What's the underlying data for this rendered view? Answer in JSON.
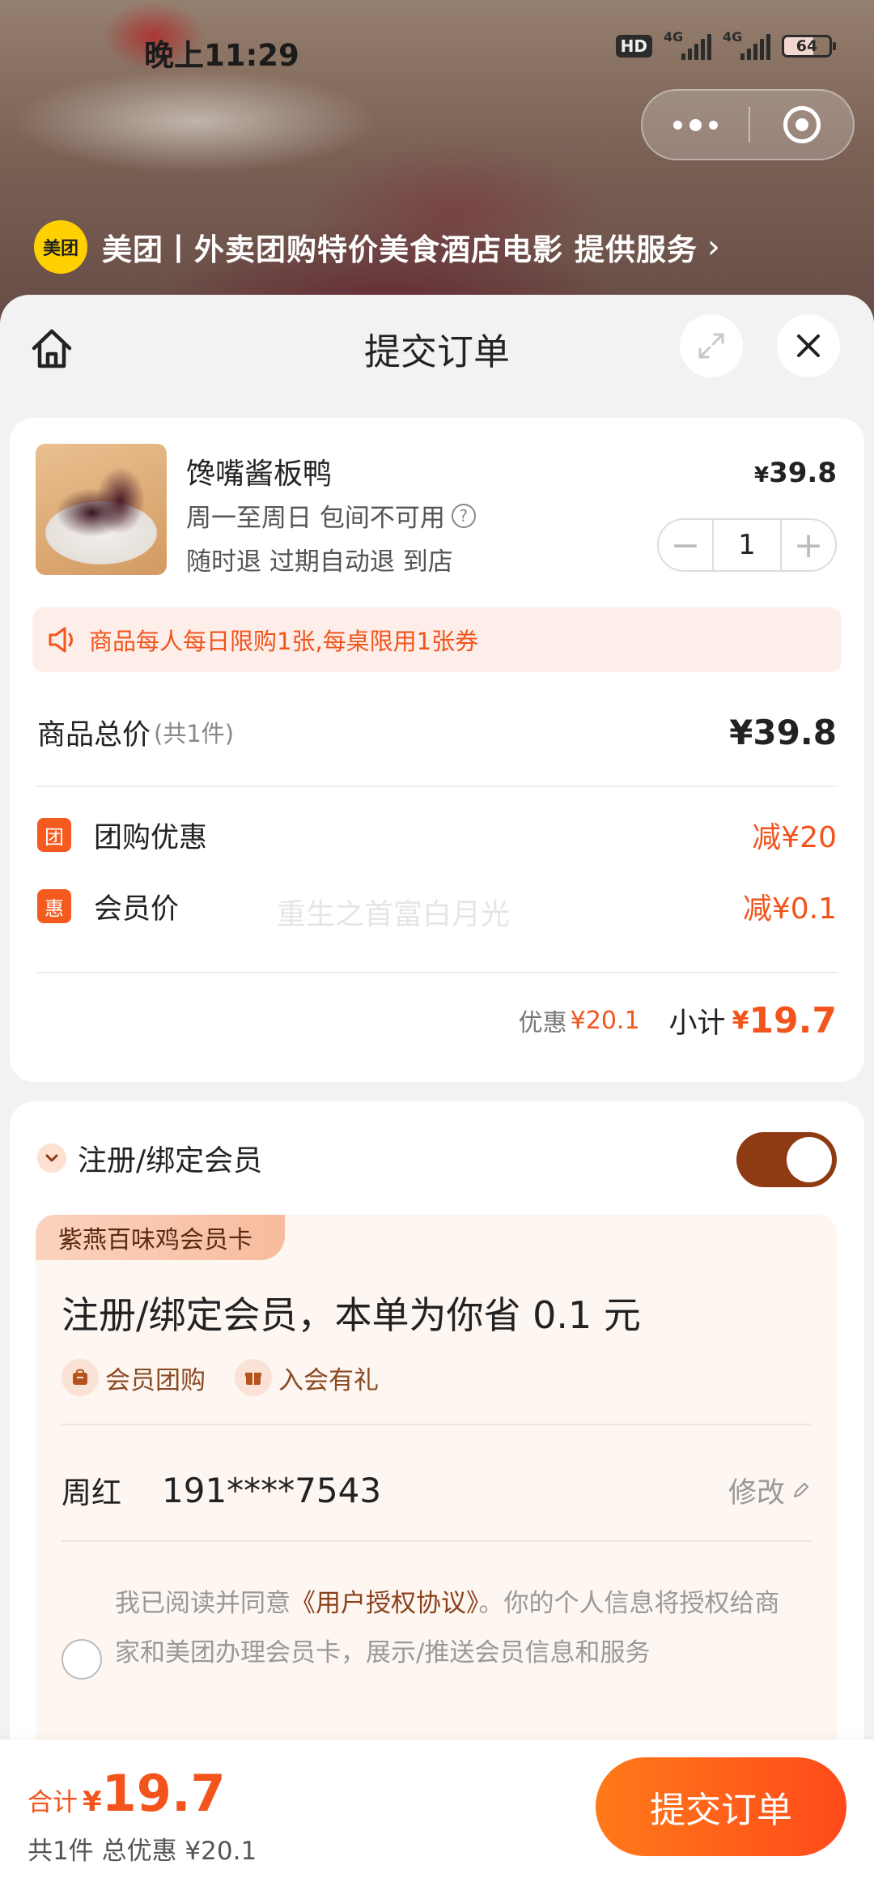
{
  "status_bar": {
    "time": "晚上11:29",
    "hd": "HD",
    "net1": "4G",
    "net2": "4G",
    "battery": "64"
  },
  "service": {
    "logo_text": "美团",
    "text": "美团丨外卖团购特价美食酒店电影 提供服务",
    "chevron": "›"
  },
  "header": {
    "title": "提交订单"
  },
  "product": {
    "name": "馋嘴酱板鸭",
    "sub1": "周一至周日 包间不可用",
    "help": "?",
    "sub2": "随时退 过期自动退 到店",
    "price_cur": "¥",
    "price": "39.8",
    "qty": "1",
    "minus": "−",
    "plus": "+"
  },
  "notice": {
    "text": "商品每人每日限购1张,每桌限用1张券"
  },
  "totals": {
    "label": "商品总价",
    "count": "(共1件)",
    "value": "¥39.8"
  },
  "discounts": [
    {
      "badge": "团",
      "label": "团购优惠",
      "value": "减¥20"
    },
    {
      "badge": "惠",
      "label": "会员价",
      "value": "减¥0.1"
    }
  ],
  "watermark": "重生之首富白月光",
  "subtotal": {
    "disc_label": "优惠",
    "disc_value": "¥20.1",
    "label": "小计",
    "cur": "¥",
    "value": "19.7"
  },
  "member": {
    "label": "注册/绑定会员",
    "toggle_on": true,
    "card_tag": "紫燕百味鸡会员卡",
    "title": "注册/绑定会员，本单为你省 0.1 元",
    "perks": [
      "会员团购",
      "入会有礼"
    ],
    "contact_name": "周红",
    "contact_phone": "191****7543",
    "edit_label": "修改",
    "agree_prefix": "我已阅读并同意",
    "agree_link": "《用户授权协议》",
    "agree_suffix": "。你的个人信息将授权给商家和美团办理会员卡，展示/推送会员信息和服务"
  },
  "bottom": {
    "sum_label": "合计",
    "sum_cur": "¥",
    "sum_value": "19.7",
    "summary": "共1件 总优惠 ¥20.1",
    "submit_label": "提交订单"
  },
  "colors": {
    "accent": "#f2541c",
    "toggle": "#8e3b14",
    "brand_yellow": "#ffd100"
  }
}
